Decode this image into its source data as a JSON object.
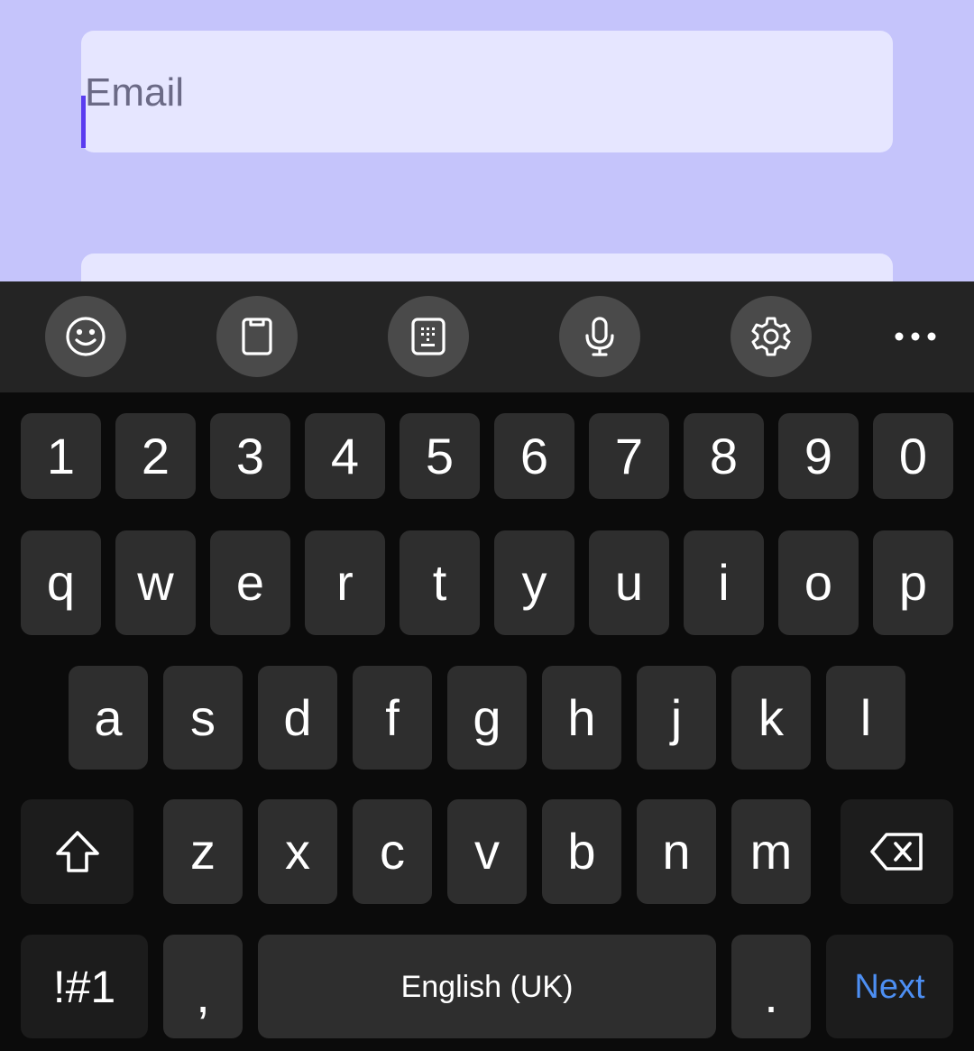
{
  "form": {
    "email_placeholder": "Email"
  },
  "toolbar": {
    "icons": [
      "emoji-icon",
      "clipboard-icon",
      "keypad-icon",
      "microphone-icon",
      "settings-icon",
      "more-icon"
    ]
  },
  "keyboard": {
    "number_row": [
      "1",
      "2",
      "3",
      "4",
      "5",
      "6",
      "7",
      "8",
      "9",
      "0"
    ],
    "row1": [
      "q",
      "w",
      "e",
      "r",
      "t",
      "y",
      "u",
      "i",
      "o",
      "p"
    ],
    "row2": [
      "a",
      "s",
      "d",
      "f",
      "g",
      "h",
      "j",
      "k",
      "l"
    ],
    "row3": [
      "z",
      "x",
      "c",
      "v",
      "b",
      "n",
      "m"
    ],
    "symbols_label": "!#1",
    "comma_label": ",",
    "space_label": "English (UK)",
    "period_label": ".",
    "action_label": "Next"
  },
  "colors": {
    "app_background": "#c5c4fb",
    "field_background": "#e6e6ff",
    "caret": "#5a3cf0",
    "keyboard_background": "#0b0b0b",
    "key_background": "#2e2e2e",
    "action_text": "#4d8ff3"
  }
}
